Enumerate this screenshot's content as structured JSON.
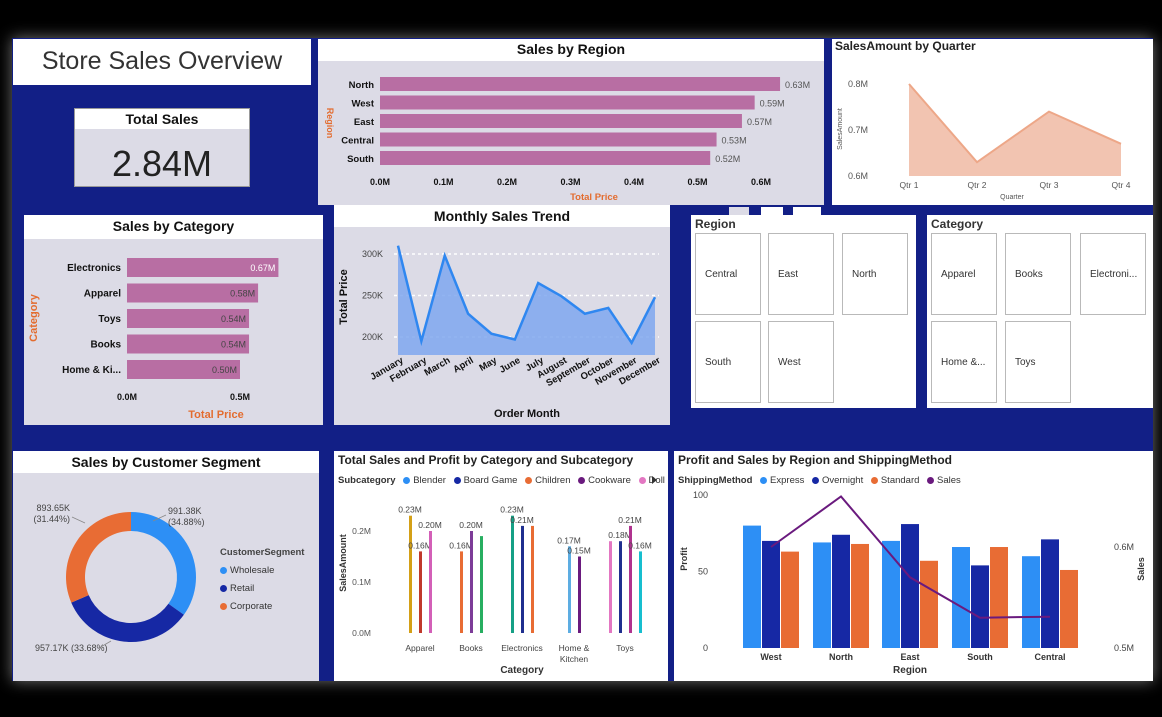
{
  "dashboard_title": "Store Sales Overview",
  "kpi": {
    "label": "Total Sales",
    "value": "2.84M"
  },
  "region_chart": {
    "title": "Sales by Region",
    "ylabel": "Region",
    "xlabel": "Total Price",
    "ticks": [
      "0.0M",
      "0.1M",
      "0.2M",
      "0.3M",
      "0.4M",
      "0.5M",
      "0.6M"
    ]
  },
  "quarter_chart": {
    "title": "SalesAmount by Quarter",
    "ylabel": "SalesAmount",
    "xlabel": "Quarter",
    "yticks": [
      "0.8M",
      "0.7M",
      "0.6M"
    ]
  },
  "category_chart": {
    "title": "Sales by Category",
    "ylabel": "Category",
    "xlabel": "Total Price",
    "ticks": [
      "0.0M",
      "0.5M"
    ]
  },
  "monthly_chart": {
    "title": "Monthly Sales Trend",
    "ylabel": "Total Price",
    "xlabel": "Order Month",
    "yticks": [
      "300K",
      "250K",
      "200K"
    ]
  },
  "region_slicer": {
    "title": "Region",
    "items": [
      "Central",
      "East",
      "North",
      "South",
      "West"
    ]
  },
  "category_slicer": {
    "title": "Category",
    "items": [
      "Apparel",
      "Books",
      "Electroni...",
      "Home &...",
      "Toys"
    ]
  },
  "segment_chart": {
    "title": "Sales by Customer Segment",
    "legend_title": "CustomerSegment",
    "labels": [
      "991.38K\n(34.88%)",
      "957.17K (33.68%)",
      "893.65K\n(31.44%)"
    ]
  },
  "subcat_chart": {
    "title": "Total Sales and Profit by Category and Subcategory",
    "legend_title": "Subcategory",
    "legend": [
      "Blender",
      "Board Game",
      "Children",
      "Cookware",
      "Doll"
    ],
    "ylabel": "SalesAmount",
    "xlabel": "Category",
    "yticks": [
      "0.2M",
      "0.1M",
      "0.0M"
    ]
  },
  "profit_chart": {
    "title": "Profit and Sales by Region and ShippingMethod",
    "legend_title": "ShippingMethod",
    "legend": [
      "Express",
      "Overnight",
      "Standard",
      "Sales"
    ],
    "ylabel": "Profit",
    "y2label": "Sales",
    "xlabel": "Region",
    "yticks": [
      "100",
      "50",
      "0"
    ],
    "y2ticks": [
      "0.6M",
      "0.5M"
    ]
  },
  "colors": {
    "canvas": "#121f86",
    "bar_pink": "#b86ea3",
    "axis_orange": "#e36c2f",
    "quarter_fill": "#f2c4b1",
    "quarter_line": "#eda788",
    "month_fill": "#7fa7ee",
    "month_line": "#2f87f0",
    "express": "#2d8ff5",
    "overnight": "#1628a4",
    "standard": "#e86c34",
    "sales_line": "#6a1a7e"
  },
  "chart_data": [
    {
      "type": "bar",
      "title": "Sales by Region",
      "xlabel": "Total Price",
      "ylabel": "Region",
      "categories": [
        "North",
        "West",
        "East",
        "Central",
        "South"
      ],
      "values": [
        0.63,
        0.59,
        0.57,
        0.53,
        0.52
      ],
      "data_labels": [
        "0.63M",
        "0.59M",
        "0.57M",
        "0.53M",
        "0.52M"
      ],
      "xlim": [
        0,
        0.6
      ]
    },
    {
      "type": "area",
      "title": "SalesAmount by Quarter",
      "xlabel": "Quarter",
      "ylabel": "SalesAmount",
      "categories": [
        "Qtr 1",
        "Qtr 2",
        "Qtr 3",
        "Qtr 4"
      ],
      "values": [
        0.8,
        0.63,
        0.74,
        0.67
      ],
      "ylim": [
        0.6,
        0.8
      ]
    },
    {
      "type": "bar",
      "title": "Sales by Category",
      "xlabel": "Total Price",
      "ylabel": "Category",
      "categories": [
        "Electronics",
        "Apparel",
        "Toys",
        "Books",
        "Home & Ki..."
      ],
      "values": [
        0.67,
        0.58,
        0.54,
        0.54,
        0.5
      ],
      "data_labels": [
        "0.67M",
        "0.58M",
        "0.54M",
        "0.54M",
        "0.50M"
      ],
      "xlim": [
        0,
        0.5
      ]
    },
    {
      "type": "area",
      "title": "Monthly Sales Trend",
      "xlabel": "Order Month",
      "ylabel": "Total Price",
      "categories": [
        "January",
        "February",
        "March",
        "April",
        "May",
        "June",
        "July",
        "August",
        "September",
        "October",
        "November",
        "December"
      ],
      "values": [
        310,
        195,
        298,
        228,
        204,
        197,
        265,
        249,
        228,
        235,
        193,
        248
      ],
      "ylim": [
        200,
        300
      ]
    },
    {
      "type": "pie",
      "title": "Sales by Customer Segment",
      "categories": [
        "Wholesale",
        "Retail",
        "Corporate"
      ],
      "values": [
        991.38,
        957.17,
        893.65
      ],
      "percent": [
        34.88,
        33.68,
        31.44
      ],
      "colors": [
        "#2d8ff5",
        "#1628a4",
        "#e86c34"
      ]
    },
    {
      "type": "bar",
      "title": "Total Sales and Profit by Category and Subcategory",
      "xlabel": "Category",
      "ylabel": "SalesAmount",
      "categories": [
        "Apparel",
        "Books",
        "Electronics",
        "Home & Kitchen",
        "Toys"
      ],
      "groups": [
        {
          "category": "Apparel",
          "bars": [
            {
              "label": "0.23M",
              "value": 0.23,
              "color": "#d4a017"
            },
            {
              "label": "0.16M",
              "value": 0.16,
              "color": "#c0392b"
            },
            {
              "label": "0.20M",
              "value": 0.2,
              "color": "#d35fb7"
            }
          ]
        },
        {
          "category": "Books",
          "bars": [
            {
              "label": "0.16M",
              "value": 0.16,
              "color": "#e86c34"
            },
            {
              "label": "0.20M",
              "value": 0.2,
              "color": "#7d3c98"
            },
            {
              "label": "",
              "value": 0.19,
              "color": "#27ae60"
            }
          ]
        },
        {
          "category": "Electronics",
          "bars": [
            {
              "label": "0.23M",
              "value": 0.23,
              "color": "#16a085"
            },
            {
              "label": "0.21M",
              "value": 0.21,
              "color": "#1f2f8f"
            },
            {
              "label": "",
              "value": 0.21,
              "color": "#e86c34"
            }
          ]
        },
        {
          "category": "Home & Kitchen",
          "bars": [
            {
              "label": "0.17M",
              "value": 0.17,
              "color": "#5dade2"
            },
            {
              "label": "0.15M",
              "value": 0.15,
              "color": "#6a1a7e"
            }
          ]
        },
        {
          "category": "Toys",
          "bars": [
            {
              "label": "",
              "value": 0.18,
              "color": "#e377c2"
            },
            {
              "label": "0.18M",
              "value": 0.18,
              "color": "#1f2f8f"
            },
            {
              "label": "0.21M",
              "value": 0.21,
              "color": "#b0338f"
            },
            {
              "label": "0.16M",
              "value": 0.16,
              "color": "#17becf"
            }
          ]
        }
      ],
      "ylim": [
        0,
        0.2
      ]
    },
    {
      "type": "bar",
      "title": "Profit and Sales by Region and ShippingMethod",
      "xlabel": "Region",
      "ylabel": "Profit",
      "categories": [
        "West",
        "North",
        "East",
        "South",
        "Central"
      ],
      "series": [
        {
          "name": "Express",
          "values": [
            80,
            69,
            70,
            66,
            60
          ]
        },
        {
          "name": "Overnight",
          "values": [
            70,
            74,
            81,
            54,
            71
          ]
        },
        {
          "name": "Standard",
          "values": [
            63,
            68,
            57,
            66,
            51
          ]
        }
      ],
      "line": {
        "name": "Sales",
        "values": [
          0.6,
          0.65,
          0.57,
          0.53,
          0.531
        ]
      },
      "ylim": [
        0,
        100
      ],
      "y2lim": [
        0.5,
        0.6
      ]
    }
  ]
}
